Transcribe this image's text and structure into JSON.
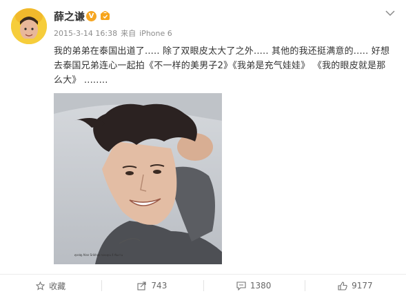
{
  "post": {
    "author": "薛之谦",
    "verified_mark": "V",
    "date": "2015-3-14 16:38",
    "source_prefix": "来自",
    "device": "iPhone 6",
    "text": "我的弟弟在泰国出道了..... 除了双眼皮太大了之外..... 其他的我还挺满意的..... 好想去泰国兄弟连心一起拍《不一样的美男子2》《我弟是充气娃娃》 《我的眼皮就是那么大》 ........",
    "image_caption": "ศุภณัฐ Alan Srikhao  ขอบคุณ 4 ทีมงาน"
  },
  "actions": {
    "favorite_label": "收藏",
    "repost_count": "743",
    "comment_count": "1380",
    "like_count": "9177"
  },
  "icons": {
    "header": [
      "chevron-down-icon",
      "verified-icon",
      "member-icon"
    ],
    "actions": [
      "star-icon",
      "repost-icon",
      "comment-icon",
      "thumbs-up-icon"
    ]
  },
  "colors": {
    "text": "#333333",
    "meta": "#8c8c8c",
    "verified": "#f5a623",
    "divider": "#ececec"
  }
}
